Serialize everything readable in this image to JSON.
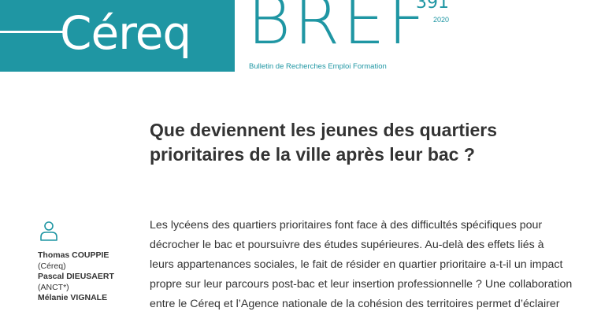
{
  "masthead": {
    "logo_text": "Céreq",
    "series_title": "BREF",
    "issue_number": "391",
    "year": "2020",
    "subtitle": "Bulletin de Recherches Emploi Formation"
  },
  "article": {
    "title": "Que deviennent les jeunes des quartiers prioritaires de la ville après leur bac ?",
    "intro_lines": [
      "Les lycéens des quartiers prioritaires font face à des difficultés spécifiques pour",
      "décrocher le bac et poursuivre des études supérieures. Au-delà des effets liés à",
      "leurs appartenances sociales, le fait de résider en quartier prioritaire a-t-il un impact",
      "propre sur leur parcours post-bac et leur insertion professionnelle ? Une collaboration",
      "entre le Céreq et l’Agence nationale de la cohésion des territoires permet d’éclairer"
    ]
  },
  "authors": [
    {
      "name": "Thomas COUPPIE",
      "org": "(Céreq)"
    },
    {
      "name": "Pascal DIEUSAERT",
      "org": "(ANCT*)"
    },
    {
      "name": "Mélanie VIGNALE",
      "org": ""
    }
  ],
  "icons": {
    "author": "person-icon"
  },
  "colors": {
    "brand_teal": "#1f96a3",
    "text": "#333333"
  }
}
